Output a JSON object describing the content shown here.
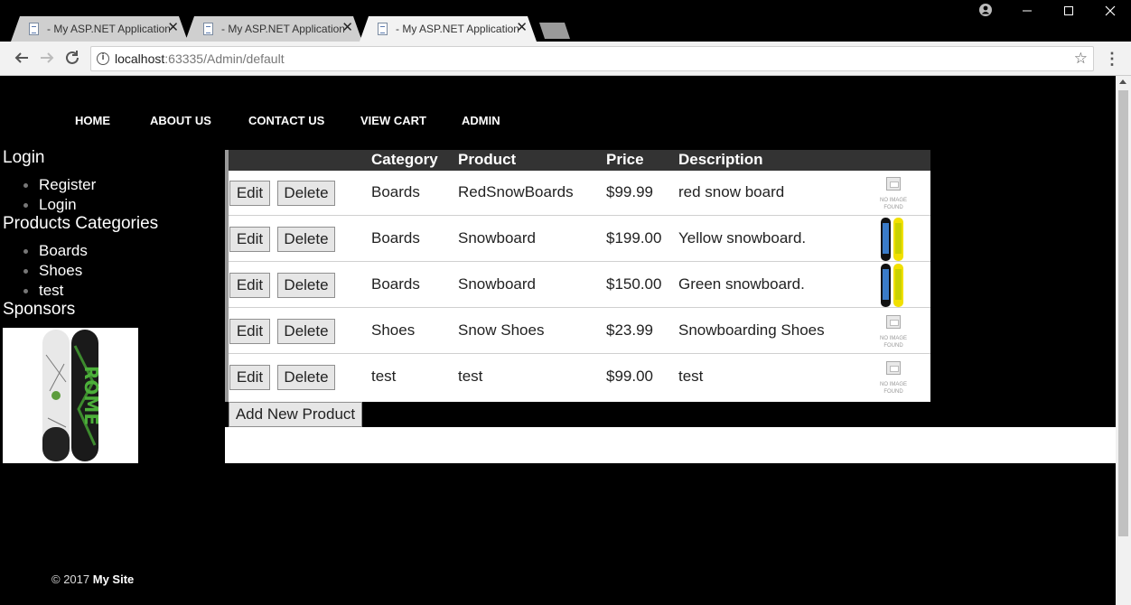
{
  "browser": {
    "tabs": [
      {
        "title": "- My ASP.NET Application",
        "active": false
      },
      {
        "title": "- My ASP.NET Application",
        "active": false
      },
      {
        "title": "- My ASP.NET Application",
        "active": true
      }
    ],
    "url_host": "localhost",
    "url_path": ":63335/Admin/default"
  },
  "nav": {
    "items": [
      "HOME",
      "ABOUT US",
      "CONTACT US",
      "VIEW CART",
      "ADMIN"
    ]
  },
  "sidebar": {
    "login_heading": "Login",
    "login_links": [
      "Register",
      "Login"
    ],
    "categories_heading": "Products Categories",
    "categories": [
      "Boards",
      "Shoes",
      "test"
    ],
    "sponsors_heading": "Sponsors",
    "sponsor_brand": "ROME"
  },
  "grid": {
    "headers": {
      "category": "Category",
      "product": "Product",
      "price": "Price",
      "description": "Description"
    },
    "edit_label": "Edit",
    "delete_label": "Delete",
    "no_image_text": "NO IMAGE FOUND",
    "rows": [
      {
        "category": "Boards",
        "product": "RedSnowBoards",
        "price": "$99.99",
        "description": "red snow board",
        "image": "no-image"
      },
      {
        "category": "Boards",
        "product": "Snowboard",
        "price": "$199.00",
        "description": "Yellow snowboard.",
        "image": "snowboard"
      },
      {
        "category": "Boards",
        "product": "Snowboard",
        "price": "$150.00",
        "description": "Green snowboard.",
        "image": "snowboard"
      },
      {
        "category": "Shoes",
        "product": "Snow Shoes",
        "price": "$23.99",
        "description": "Snowboarding Shoes",
        "image": "no-image"
      },
      {
        "category": "test",
        "product": "test",
        "price": "$99.00",
        "description": "test",
        "image": "no-image"
      }
    ],
    "add_button": "Add New Product"
  },
  "footer": {
    "copyright": "© 2017",
    "site": "My Site"
  }
}
